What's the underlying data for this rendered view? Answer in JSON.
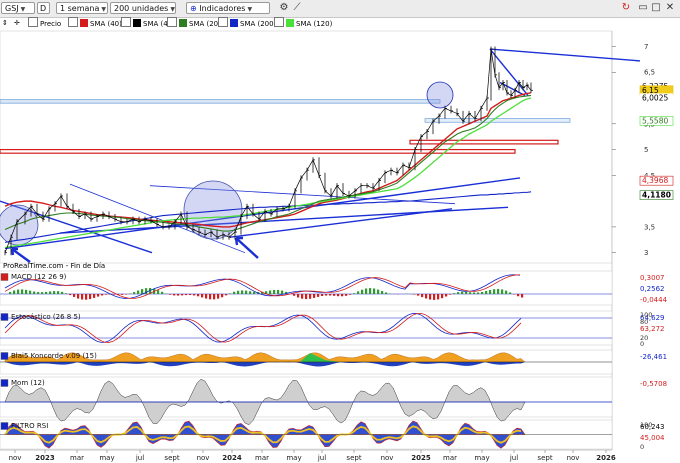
{
  "toolbar": {
    "symbol": "GSJ",
    "type_letter": "D",
    "period": "1 semana",
    "units": "200 unidades",
    "indicators": "Indicadores"
  },
  "legend": {
    "price": "Precio",
    "sma40": "SMA (40)",
    "sma4": "SMA (4)",
    "sma20": "SMA (20)",
    "sma200": "SMA (200)",
    "sma120": "SMA (120)"
  },
  "source": "ProRealTime.com - Fin de Día",
  "colors": {
    "sma40": "#d41c1c",
    "sma4": "#000000",
    "sma20": "#2e7d1f",
    "sma200": "#1226c8",
    "sma120": "#4de03a",
    "trendline": "#1a2fd6",
    "zone_red": "#d41c1c",
    "zone_blue": "#6a9ed8"
  },
  "x_labels": [
    "nov",
    "2023",
    "mar",
    "may",
    "jul",
    "sept",
    "nov",
    "2024",
    "mar",
    "may",
    "jul",
    "sept",
    "nov",
    "2025",
    "mar",
    "may",
    "jul",
    "sept",
    "nov",
    "2026"
  ],
  "chart_data": [
    {
      "type": "line",
      "name": "price",
      "yticks": [
        "7",
        "6,5",
        "5,5",
        "5",
        "4,5",
        "3,5",
        "3"
      ],
      "ylim": [
        2.8,
        7.3
      ],
      "x": [
        0,
        6,
        12,
        20,
        26,
        32,
        38,
        44,
        50,
        56,
        62,
        68,
        74,
        80,
        86,
        92,
        98,
        104,
        110,
        116,
        122,
        128,
        134,
        140,
        146,
        152,
        158,
        164,
        170,
        176,
        182,
        188,
        194,
        200,
        206,
        212,
        218,
        224,
        230,
        236,
        242,
        248,
        254,
        260,
        266,
        272,
        278,
        284,
        290,
        296,
        302,
        308,
        314,
        320,
        326,
        332,
        338,
        344,
        350,
        356,
        362,
        368,
        374,
        380,
        386,
        392,
        398,
        404,
        410,
        416,
        422,
        428,
        434,
        440,
        446,
        452,
        458,
        464,
        470,
        476,
        482,
        486,
        490,
        494,
        498,
        502,
        506,
        510,
        514,
        518,
        522,
        526
      ],
      "values": [
        3.0,
        3.3,
        3.6,
        3.75,
        3.9,
        3.75,
        3.65,
        3.85,
        3.95,
        4.1,
        3.9,
        3.8,
        3.7,
        3.75,
        3.65,
        3.7,
        3.75,
        3.7,
        3.65,
        3.6,
        3.6,
        3.65,
        3.6,
        3.65,
        3.62,
        3.55,
        3.5,
        3.5,
        3.6,
        3.75,
        3.5,
        3.45,
        3.4,
        3.35,
        3.4,
        3.3,
        3.35,
        3.3,
        3.4,
        3.7,
        3.9,
        3.75,
        3.65,
        3.8,
        3.75,
        3.85,
        3.85,
        3.9,
        4.2,
        4.45,
        4.6,
        4.8,
        4.5,
        4.2,
        4.1,
        4.3,
        4.15,
        4.1,
        4.2,
        4.3,
        4.3,
        4.25,
        4.4,
        4.55,
        4.6,
        4.55,
        4.7,
        4.65,
        5.0,
        5.25,
        5.35,
        5.55,
        5.65,
        5.8,
        5.75,
        5.7,
        5.55,
        5.7,
        5.6,
        5.8,
        6.0,
        6.95,
        6.45,
        6.2,
        6.3,
        6.1,
        6.05,
        6.15,
        6.3,
        6.2,
        6.25,
        6.15
      ],
      "sma40": [
        3.9,
        3.95,
        3.98,
        4.0,
        4.0,
        3.98,
        3.96,
        3.93,
        3.9,
        3.88,
        3.85,
        3.82,
        3.8,
        3.78,
        3.76,
        3.74,
        3.73,
        3.71,
        3.7,
        3.69,
        3.68,
        3.67,
        3.65,
        3.64,
        3.63,
        3.62,
        3.61,
        3.6,
        3.59,
        3.58,
        3.57,
        3.56,
        3.55,
        3.53,
        3.52,
        3.51,
        3.5,
        3.5,
        3.52,
        3.55,
        3.58,
        3.6,
        3.62,
        3.64,
        3.66,
        3.68,
        3.7,
        3.72,
        3.75,
        3.8,
        3.85,
        3.9,
        3.95,
        3.98,
        4.0,
        4.02,
        4.05,
        4.08,
        4.12,
        4.15,
        4.18,
        4.2,
        4.25,
        4.3,
        4.35,
        4.4,
        4.5,
        4.6,
        4.7,
        4.8,
        4.9,
        5.0,
        5.1,
        5.2,
        5.3,
        5.4,
        5.45,
        5.5,
        5.55,
        5.6,
        5.65,
        5.8,
        5.85,
        5.9,
        5.95,
        5.97,
        6.0,
        6.02,
        6.05,
        6.07,
        6.09,
        6.1
      ],
      "sma20": [
        3.45,
        3.5,
        3.55,
        3.6,
        3.65,
        3.68,
        3.7,
        3.72,
        3.74,
        3.76,
        3.77,
        3.77,
        3.76,
        3.75,
        3.73,
        3.72,
        3.71,
        3.7,
        3.69,
        3.68,
        3.66,
        3.65,
        3.63,
        3.62,
        3.61,
        3.6,
        3.59,
        3.57,
        3.56,
        3.55,
        3.54,
        3.52,
        3.5,
        3.48,
        3.46,
        3.44,
        3.42,
        3.42,
        3.44,
        3.48,
        3.52,
        3.56,
        3.6,
        3.63,
        3.66,
        3.7,
        3.72,
        3.75,
        3.8,
        3.85,
        3.9,
        3.95,
        4.0,
        4.02,
        4.04,
        4.06,
        4.08,
        4.1,
        4.12,
        4.14,
        4.16,
        4.18,
        4.22,
        4.26,
        4.3,
        4.35,
        4.45,
        4.55,
        4.65,
        4.75,
        4.85,
        4.95,
        5.05,
        5.15,
        5.22,
        5.3,
        5.35,
        5.38,
        5.42,
        5.5,
        5.6,
        5.7,
        5.78,
        5.85,
        5.9,
        5.95,
        5.98,
        6.0,
        6.02,
        6.03,
        6.04,
        6.05
      ],
      "sma200": [
        3.2,
        3.22,
        3.24,
        3.26,
        3.28,
        3.3,
        3.32,
        3.34,
        3.36,
        3.38,
        3.4,
        3.42,
        3.44,
        3.46,
        3.48,
        3.5,
        3.52,
        3.54,
        3.56,
        3.58,
        3.6,
        3.62,
        3.64,
        3.66,
        3.68,
        3.7,
        3.72,
        3.73,
        3.74,
        3.75,
        3.76,
        3.77,
        3.78,
        3.79,
        3.8,
        3.81,
        3.82,
        3.83,
        3.84,
        3.85,
        3.86,
        3.87,
        3.88,
        3.88,
        3.89,
        3.89,
        3.9,
        3.9,
        3.91,
        3.91,
        3.92,
        3.92,
        3.93,
        3.93,
        3.94,
        3.94,
        3.95,
        3.95,
        3.96,
        3.96,
        3.97,
        3.97,
        3.98,
        3.98,
        3.99,
        3.99,
        4.0,
        4.0,
        4.01,
        4.02,
        4.03,
        4.04,
        4.05,
        4.06,
        4.07,
        4.08,
        4.09,
        4.1,
        4.11,
        4.12,
        4.12,
        4.13,
        4.13,
        4.14,
        4.14,
        4.15,
        4.15,
        4.16,
        4.16,
        4.17,
        4.17,
        4.18
      ],
      "sma120": [
        3.1,
        3.12,
        3.14,
        3.16,
        3.18,
        3.2,
        3.22,
        3.24,
        3.26,
        3.28,
        3.3,
        3.32,
        3.34,
        3.36,
        3.38,
        3.4,
        3.42,
        3.44,
        3.46,
        3.48,
        3.5,
        3.52,
        3.54,
        3.56,
        3.58,
        3.6,
        3.62,
        3.63,
        3.64,
        3.65,
        3.66,
        3.67,
        3.67,
        3.68,
        3.68,
        3.69,
        3.69,
        3.7,
        3.71,
        3.72,
        3.74,
        3.76,
        3.78,
        3.8,
        3.82,
        3.84,
        3.86,
        3.88,
        3.9,
        3.92,
        3.94,
        3.96,
        3.98,
        4.0,
        4.02,
        4.04,
        4.06,
        4.08,
        4.1,
        4.12,
        4.14,
        4.16,
        4.18,
        4.2,
        4.22,
        4.24,
        4.3,
        4.38,
        4.46,
        4.55,
        4.65,
        4.75,
        4.85,
        4.95,
        5.05,
        5.15,
        5.22,
        5.3,
        5.36,
        5.42,
        5.48,
        5.55,
        5.6,
        5.65,
        5.7,
        5.75,
        5.8,
        5.85,
        5.9,
        5.95,
        5.98,
        6.0
      ],
      "labels": [
        {
          "text": "6,2275",
          "y": 6.2275,
          "color": "#ffffff",
          "bg": "#ffffff",
          "fg": "#000000"
        },
        {
          "text": "6,15",
          "y": 6.15,
          "color": "#e6b800",
          "bg": "#f2cc1a",
          "fg": "#000000"
        },
        {
          "text": "6,0025",
          "y": 6.0025,
          "color": "#ffffff",
          "bg": "#ffffff",
          "fg": "#000000"
        },
        {
          "text": "5,5580",
          "y": 5.558,
          "color": "#4de03a",
          "bg": "#ffffff",
          "fg": "#2e7d1f"
        },
        {
          "text": "4,3968",
          "y": 4.3968,
          "color": "#d41c1c",
          "bg": "#ffffff",
          "fg": "#d41c1c"
        },
        {
          "text": "4,1180",
          "y": 4.118,
          "color": "#2e7d1f",
          "bg": "#ffffff",
          "fg": "#000000"
        }
      ]
    },
    {
      "type": "bar",
      "name": "MACD (12 26 9)",
      "labels": [
        {
          "text": "0,3007",
          "y": 0.3007,
          "fg": "#d41c1c"
        },
        {
          "text": "0,2562",
          "y": 0.2562,
          "fg": "#1226c8"
        },
        {
          "text": "-0,0444",
          "y": -0.0444,
          "fg": "#d41c1c"
        }
      ]
    },
    {
      "type": "line",
      "name": "Estocástico (26 8 5)",
      "yticks": [
        "100",
        "80",
        "20",
        "0"
      ],
      "labels": [
        {
          "text": "64,629",
          "y": 64.629,
          "fg": "#1226c8"
        },
        {
          "text": "63,272",
          "y": 63.272,
          "fg": "#d41c1c"
        }
      ]
    },
    {
      "type": "area",
      "name": "Blai5 Koncorde v.09 (15)",
      "labels": [
        {
          "text": "-26,461",
          "y": -26.461,
          "fg": "#1226c8"
        }
      ]
    },
    {
      "type": "area",
      "name": "Mom (12)",
      "labels": [
        {
          "text": "-0,5708",
          "y": -0.5708,
          "fg": "#d41c1c"
        }
      ]
    },
    {
      "type": "area",
      "name": "FILTRO RSI",
      "yticks": [
        "100",
        "0"
      ],
      "labels": [
        {
          "text": "60,243",
          "y": 60.243,
          "fg": "#000000"
        },
        {
          "text": "45,004",
          "y": 45.004,
          "fg": "#d41c1c"
        }
      ]
    }
  ]
}
